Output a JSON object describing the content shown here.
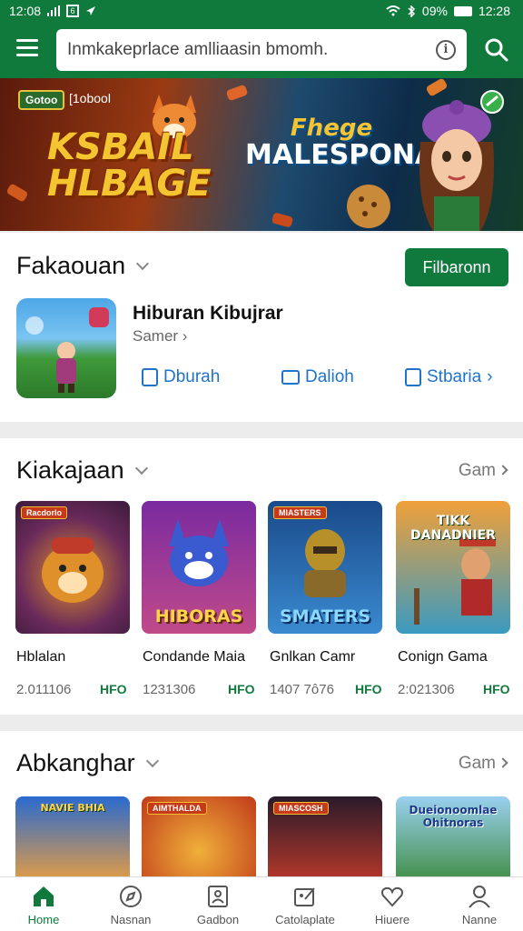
{
  "status_bar": {
    "time_left": "12:08",
    "notification_box": "6",
    "battery_percent": "09%",
    "time_right": "12:28"
  },
  "search": {
    "value": "Inmkakeprlace amlliaasin bmomh."
  },
  "banner": {
    "badge": "Gotoo",
    "tag": "[1obool",
    "title_left_1": "KSBAIL",
    "title_left_2": "HLBAGE",
    "title_right_1": "Fhege",
    "title_right_2": "MALESPONA"
  },
  "featured": {
    "section_title": "Fakaouan",
    "button_label": "Filbaronn",
    "app_name": "Hiburan Kibujrar",
    "app_category": "Samer",
    "actions": [
      "Dburah",
      "Dalioh",
      "Stbaria"
    ]
  },
  "section2": {
    "title": "Kiakajaan",
    "more": "Gam",
    "games": [
      {
        "name": "Hblalan",
        "stat": "2.011106",
        "badge": "HFO",
        "tag": "Racdorlo",
        "title": ""
      },
      {
        "name": "Condande Maia",
        "stat": "1231306",
        "badge": "HFO",
        "tag": "",
        "title": "HIBORAS"
      },
      {
        "name": "Gnlkan Camr",
        "stat": "1407 7ô76",
        "badge": "HFO",
        "tag": "MIASTERS",
        "title": "SMATERS"
      },
      {
        "name": "Conign Gama",
        "stat": "2:021306",
        "badge": "HFO",
        "tag": "",
        "title": "TIKK DANADNIER"
      }
    ]
  },
  "section3": {
    "title": "Abkanghar",
    "more": "Gam",
    "tiles": [
      {
        "tag": "",
        "title": "NAVIE BHIA"
      },
      {
        "tag": "AIMTHALDA",
        "title": ""
      },
      {
        "tag": "MIASCOSH",
        "title": ""
      },
      {
        "tag": "",
        "title": "Dueionoomlae Ohitnoras"
      }
    ]
  },
  "bottom_nav": [
    {
      "label": "Home",
      "icon": "home-icon"
    },
    {
      "label": "Nasnan",
      "icon": "compass-icon"
    },
    {
      "label": "Gadbon",
      "icon": "profile-card-icon"
    },
    {
      "label": "Catolaplate",
      "icon": "edit-image-icon"
    },
    {
      "label": "Hiuere",
      "icon": "heart-icon"
    },
    {
      "label": "Nanne",
      "icon": "user-icon"
    }
  ],
  "colors": {
    "brand_green": "#0f7a3c",
    "link_blue": "#1f73c8"
  }
}
